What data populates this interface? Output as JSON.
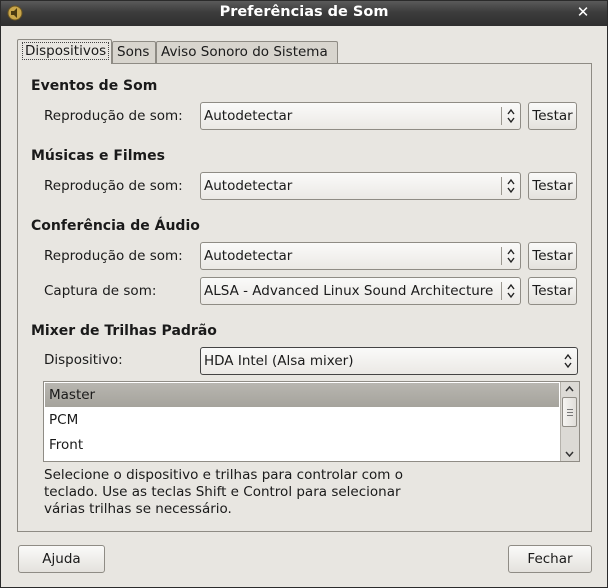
{
  "window": {
    "title": "Preferências de Som",
    "close_glyph": "✕"
  },
  "tabs": [
    {
      "label": "Dispositivos",
      "active": true
    },
    {
      "label": "Sons",
      "active": false
    },
    {
      "label": "Aviso Sonoro do Sistema",
      "active": false
    }
  ],
  "sound_events": {
    "heading": "Eventos de Som",
    "playback_label": "Reprodução de som:",
    "playback_value": "Autodetectar",
    "test_label": "Testar"
  },
  "music_movies": {
    "heading": "Músicas e Filmes",
    "playback_label": "Reprodução de som:",
    "playback_value": "Autodetectar",
    "test_label": "Testar"
  },
  "audio_conference": {
    "heading": "Conferência de Áudio",
    "playback_label": "Reprodução de som:",
    "playback_value": "Autodetectar",
    "playback_test_label": "Testar",
    "capture_label": "Captura de som:",
    "capture_value": "ALSA - Advanced Linux Sound Architecture",
    "capture_test_label": "Testar"
  },
  "mixer": {
    "heading": "Mixer de Trilhas Padrão",
    "device_label": "Dispositivo:",
    "device_value": "HDA Intel (Alsa mixer)",
    "tracks": [
      "Master",
      "PCM",
      "Front"
    ],
    "selected_track": "Master",
    "hint": "Selecione o dispositivo e trilhas para controlar com o teclado. Use as teclas Shift e Control para selecionar várias trilhas se necessário."
  },
  "footer": {
    "help_label": "Ajuda",
    "close_label": "Fechar"
  },
  "icons": [
    "sound-preferences-app-icon",
    "close-icon",
    "combo-arrows-icon",
    "scroll-up-icon",
    "scroll-down-icon"
  ]
}
